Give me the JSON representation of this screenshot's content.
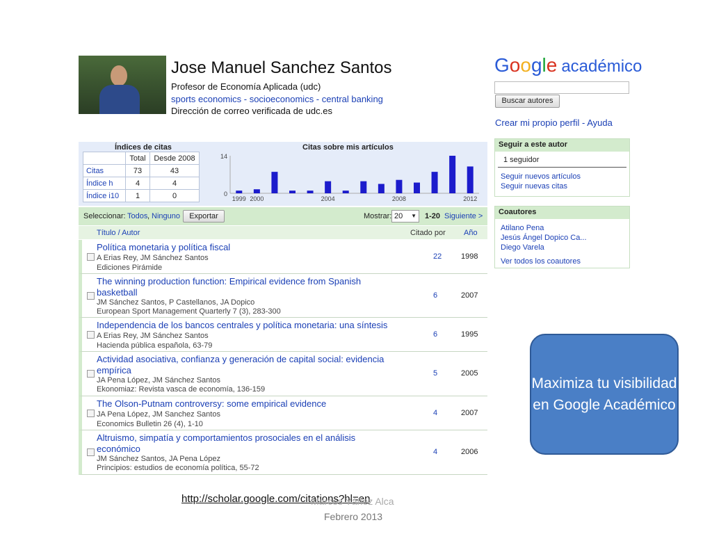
{
  "profile": {
    "name": "Jose Manuel Sanchez Santos",
    "title": "Profesor de Economía Aplicada (udc)",
    "tags": "sports economics - socioeconomics - central banking",
    "email": "Dirección de correo verificada de udc.es"
  },
  "stats": {
    "title": "Índices de citas",
    "headers": [
      "",
      "Total",
      "Desde 2008"
    ],
    "rows": [
      {
        "label": "Citas",
        "total": "73",
        "since": "43"
      },
      {
        "label": "Índice h",
        "total": "4",
        "since": "4"
      },
      {
        "label": "Índice i10",
        "total": "1",
        "since": "0"
      }
    ]
  },
  "chart_data": {
    "type": "bar",
    "title": "Citas sobre mis artículos",
    "x": [
      1999,
      2000,
      2001,
      2002,
      2003,
      2004,
      2005,
      2006,
      2007,
      2008,
      2009,
      2010,
      2011,
      2012
    ],
    "values": [
      1,
      1.5,
      8,
      1,
      1,
      4.5,
      1,
      4.5,
      3.5,
      5,
      4,
      8,
      14,
      10
    ],
    "xticks": [
      "1999",
      "2000",
      "2004",
      "2008",
      "2012"
    ],
    "yticks": [
      "0",
      "14"
    ],
    "ylim": [
      0,
      14
    ],
    "color": "#1c1ccc"
  },
  "toolbar": {
    "select_label": "Seleccionar:",
    "all": "Todos",
    "none": "Ninguno",
    "export": "Exportar",
    "show_label": "Mostrar:",
    "show_value": "20",
    "range": "1-20",
    "next": "Siguiente >"
  },
  "columns": {
    "title": "Título / Autor",
    "cited": "Citado por",
    "year": "Año"
  },
  "articles": [
    {
      "title": "Política monetaria y política fiscal",
      "authors": "A Erias Rey, JM Sánchez Santos",
      "source": "Ediciones Pirámide",
      "cites": "22",
      "year": "1998"
    },
    {
      "title": "The winning production function: Empirical evidence from Spanish basketball",
      "authors": "JM Sánchez Santos, P Castellanos, JA Dopico",
      "source": "European Sport Management Quarterly 7 (3), 283-300",
      "cites": "6",
      "year": "2007"
    },
    {
      "title": "Independencia de los bancos centrales y política monetaria: una síntesis",
      "authors": "A Erias Rey, JM Sánchez Santos",
      "source": "Hacienda pública española, 63-79",
      "cites": "6",
      "year": "1995"
    },
    {
      "title": "Actividad asociativa, confianza y generación de capital social: evidencia empírica",
      "authors": "JA Pena López, JM Sánchez Santos",
      "source": "Ekonomiaz: Revista vasca de economía, 136-159",
      "cites": "5",
      "year": "2005"
    },
    {
      "title": "The Olson-Putnam controversy: some empirical evidence",
      "authors": "JA Pena López, JM Sanchez Santos",
      "source": "Economics Bulletin 26 (4), 1-10",
      "cites": "4",
      "year": "2007"
    },
    {
      "title": "Altruismo, simpatía y comportamientos prosociales en el análisis económico",
      "authors": "JM Sánchez Santos, JA Pena López",
      "source": "Principios: estudios de economía política, 55-72",
      "cites": "4",
      "year": "2006"
    }
  ],
  "sidebar": {
    "logo_google": "Google",
    "logo_academic": "académico",
    "search_button": "Buscar autores",
    "create_profile": "Crear mi propio perfil - Ayuda",
    "follow": {
      "title": "Seguir a este autor",
      "followers": "1 seguidor",
      "new_articles": "Seguir nuevos artículos",
      "new_citations": "Seguir nuevas citas"
    },
    "coauthors": {
      "title": "Coautores",
      "items": [
        "Atilano Pena",
        "Jesús Ángel Dopico Ca...",
        "Diego Varela"
      ],
      "see_all": "Ver todos los coautores"
    }
  },
  "callout": "Maximiza tu visibilidad en Google Académico",
  "footer": {
    "url": "http://scholar.google.com/citations?hl=en",
    "author": "Marcos Yáñez Alca",
    "date": "Febrero 2013"
  }
}
